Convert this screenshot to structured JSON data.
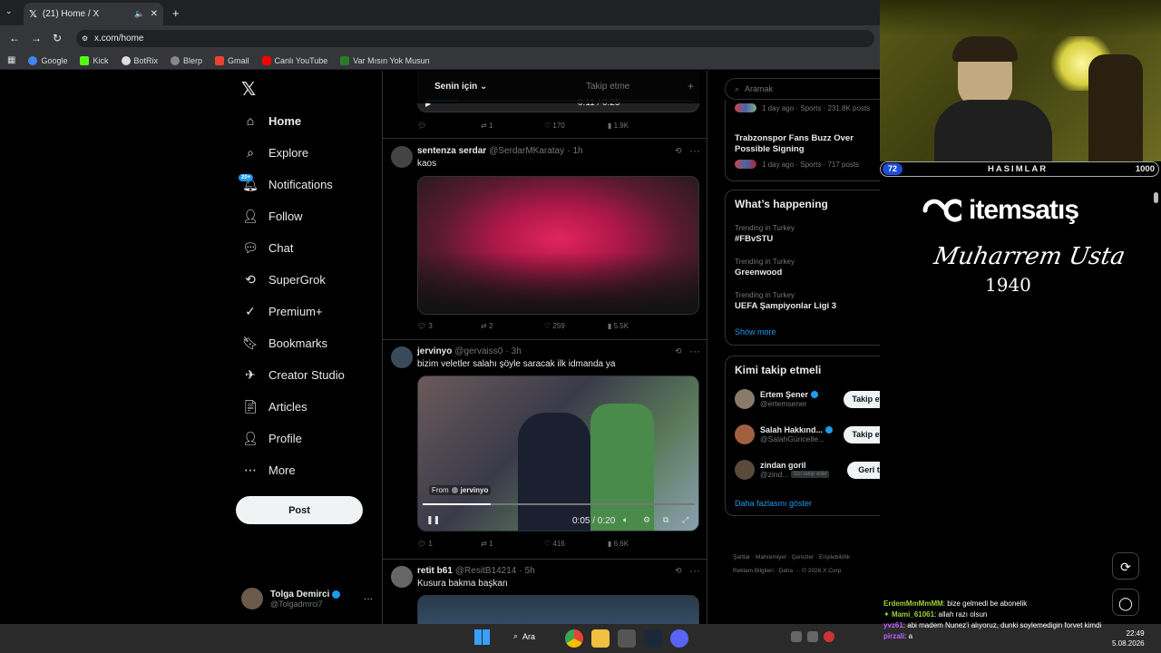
{
  "browser": {
    "tab_title": "(21) Home / X",
    "url": "x.com/home",
    "bookmarks": [
      "Google",
      "Kick",
      "BotRix",
      "Blerp",
      "Gmail",
      "Canlı YouTube",
      "Var Mısın Yok Musun"
    ]
  },
  "nav": {
    "items": [
      "Home",
      "Explore",
      "Notifications",
      "Follow",
      "Chat",
      "SuperGrok",
      "Premium+",
      "Bookmarks",
      "Creator Studio",
      "Articles",
      "Profile",
      "More"
    ],
    "notif_badge": "20+",
    "post_label": "Post",
    "user_name": "Tolga Demirci",
    "user_handle": "@Tolgadmrci7"
  },
  "feed": {
    "tabs": [
      "Senin için",
      "Takip etme"
    ],
    "top_video_time": "0:11 / 0:25",
    "top_stats": [
      "",
      "1",
      "170",
      "1.9K"
    ],
    "tweets": [
      {
        "name": "sentenza serdar",
        "handle": "@SerdarMKaratay",
        "time": "1h",
        "text": "kaos",
        "stats": [
          "3",
          "2",
          "259",
          "5.5K"
        ]
      },
      {
        "name": "jervinyo",
        "handle": "@gervaiss0",
        "time": "3h",
        "text": "bizim veletler salahı şöyle saracak ilk idmanda ya",
        "stats": [
          "1",
          "1",
          "416",
          "6.6K"
        ],
        "from_label": "From",
        "from_name": "jervinyo",
        "video_time": "0:05 / 0:20"
      },
      {
        "name": "retit b61",
        "handle": "@ResitB14214",
        "time": "5h",
        "text": "Kusura bakma başkan"
      }
    ]
  },
  "right": {
    "search_placeholder": "Aramak",
    "top_news": [
      {
        "meta": "1 day ago · Sports · 231.8K posts"
      },
      {
        "title": "Trabzonspor Fans Buzz Over Possible Signing",
        "meta": "1 day ago · Sports · 717 posts"
      }
    ],
    "whats_happening": "What’s happening",
    "trends": [
      {
        "meta": "Trending in Turkey",
        "name": "#FBvSTU"
      },
      {
        "meta": "Trending in Turkey",
        "name": "Greenwood"
      },
      {
        "meta": "Trending in Turkey",
        "name": "UEFA Şampiyonlar Ligi 3"
      }
    ],
    "show_more": "Show more",
    "who_to_follow": "Kimi takip etmeli",
    "follows": [
      {
        "name": "Ertem Şener",
        "handle": "@ertemsener",
        "button": "Takip etmek"
      },
      {
        "name": "Salah Hakkınd...",
        "handle": "@SalahGüncelle...",
        "button": "Takip etmek"
      },
      {
        "name": "zindan goril",
        "handle": "@zind...",
        "badge": "Sizi takip eder",
        "button": "Geri takip"
      }
    ],
    "more_link": "Daha fazlasını göster",
    "footer": [
      "Şartlar",
      "Mahremiyet",
      "Çerezler",
      "Erişilebilirlik",
      "Reklam Bilgileri",
      "Daha ···",
      "© 2026 X Corp."
    ]
  },
  "stream": {
    "level": "72",
    "team": "HASIMLAR",
    "points": "1000",
    "sponsor": "itemsatış",
    "signature": "Muharrem Usta",
    "signature_number": "1940",
    "chat": [
      {
        "user": "ErdemMmMmMM",
        "msg": ": bize gelmedi be abonelik"
      },
      {
        "user": "Mami_61061",
        "msg": ": allah razı olsun"
      },
      {
        "user": "yvz61",
        "msg": ": abi madem Nunez'i alıyoruz, dunki soylemedigin forvet kimdi"
      },
      {
        "user": "pirzali",
        "msg": ": a"
      }
    ]
  },
  "taskbar": {
    "search": "Ara",
    "time": "22:49",
    "date": "5.08.2026"
  },
  "colors": {
    "accent": "#1d9bf0",
    "pink_flare": "#e0245e"
  }
}
